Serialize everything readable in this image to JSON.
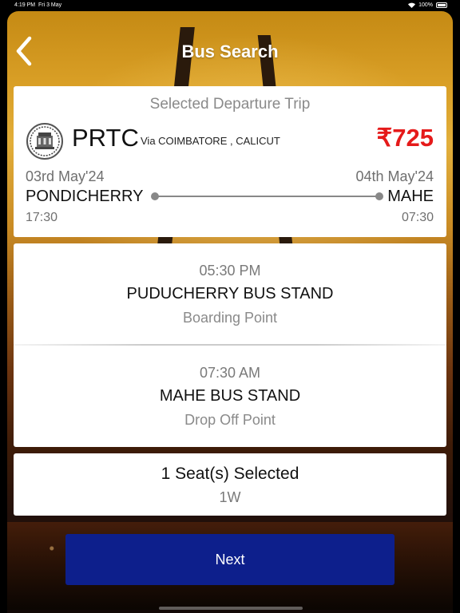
{
  "status_bar": {
    "time": "4:19 PM",
    "date": "Fri 3 May",
    "battery": "100%"
  },
  "nav": {
    "title": "Bus Search"
  },
  "trip": {
    "header": "Selected Departure Trip",
    "operator": "PRTC",
    "via": "Via COIMBATORE , CALICUT",
    "price": "₹725",
    "departure_date": "03rd May'24",
    "arrival_date": "04th May'24",
    "from": "PONDICHERRY",
    "to": "MAHE",
    "departure_time": "17:30",
    "arrival_time": "07:30"
  },
  "boarding": {
    "time": "05:30 PM",
    "name": "PUDUCHERRY BUS STAND",
    "label": "Boarding Point"
  },
  "drop": {
    "time": "07:30 AM",
    "name": "MAHE BUS STAND",
    "label": "Drop Off Point"
  },
  "seats": {
    "title": "1 Seat(s) Selected",
    "list": "1W"
  },
  "next_label": "Next",
  "colors": {
    "price": "#e51a1a",
    "button": "#0d1f8c"
  },
  "icons": {
    "back": "chevron-left-icon",
    "wifi": "wifi-icon",
    "battery": "battery-icon",
    "logo": "prtc-logo"
  }
}
